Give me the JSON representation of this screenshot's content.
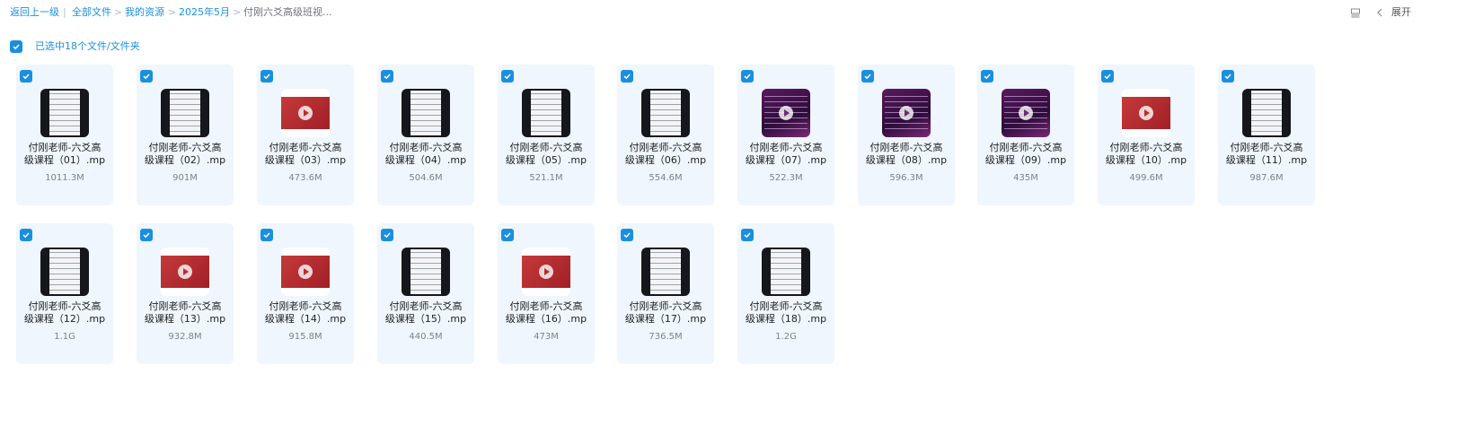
{
  "breadcrumb": {
    "back": "返回上一级",
    "items": [
      "全部文件",
      "我的资源",
      "2025年5月"
    ],
    "current": "付刚六爻高级班视..."
  },
  "toolbar": {
    "expand_label": "展开",
    "icons": [
      "list-view-icon",
      "chevron-left-icon"
    ]
  },
  "selection": {
    "text": "已选中18个文件/文件夹",
    "all_checked": true
  },
  "files": [
    {
      "name_line1": "付刚老师-六爻高",
      "name_line2": "级课程（01）.mp",
      "size": "1011.3M",
      "thumb": "doc"
    },
    {
      "name_line1": "付刚老师-六爻高",
      "name_line2": "级课程（02）.mp",
      "size": "901M",
      "thumb": "doc"
    },
    {
      "name_line1": "付刚老师-六爻高",
      "name_line2": "级课程（03）.mp",
      "size": "473.6M",
      "thumb": "red"
    },
    {
      "name_line1": "付刚老师-六爻高",
      "name_line2": "级课程（04）.mp",
      "size": "504.6M",
      "thumb": "doc"
    },
    {
      "name_line1": "付刚老师-六爻高",
      "name_line2": "级课程（05）.mp",
      "size": "521.1M",
      "thumb": "doc"
    },
    {
      "name_line1": "付刚老师-六爻高",
      "name_line2": "级课程（06）.mp",
      "size": "554.6M",
      "thumb": "doc"
    },
    {
      "name_line1": "付刚老师-六爻高",
      "name_line2": "级课程（07）.mp",
      "size": "522.3M",
      "thumb": "purple"
    },
    {
      "name_line1": "付刚老师-六爻高",
      "name_line2": "级课程（08）.mp",
      "size": "596.3M",
      "thumb": "purple"
    },
    {
      "name_line1": "付刚老师-六爻高",
      "name_line2": "级课程（09）.mp",
      "size": "435M",
      "thumb": "purple"
    },
    {
      "name_line1": "付刚老师-六爻高",
      "name_line2": "级课程（10）.mp",
      "size": "499.6M",
      "thumb": "red"
    },
    {
      "name_line1": "付刚老师-六爻高",
      "name_line2": "级课程（11）.mp",
      "size": "987.6M",
      "thumb": "doc"
    },
    {
      "name_line1": "付刚老师-六爻高",
      "name_line2": "级课程（12）.mp",
      "size": "1.1G",
      "thumb": "doc"
    },
    {
      "name_line1": "付刚老师-六爻高",
      "name_line2": "级课程（13）.mp",
      "size": "932.8M",
      "thumb": "red"
    },
    {
      "name_line1": "付刚老师-六爻高",
      "name_line2": "级课程（14）.mp",
      "size": "915.8M",
      "thumb": "red"
    },
    {
      "name_line1": "付刚老师-六爻高",
      "name_line2": "级课程（15）.mp",
      "size": "440.5M",
      "thumb": "doc"
    },
    {
      "name_line1": "付刚老师-六爻高",
      "name_line2": "级课程（16）.mp",
      "size": "473M",
      "thumb": "red"
    },
    {
      "name_line1": "付刚老师-六爻高",
      "name_line2": "级课程（17）.mp",
      "size": "736.5M",
      "thumb": "doc"
    },
    {
      "name_line1": "付刚老师-六爻高",
      "name_line2": "级课程（18）.mp",
      "size": "1.2G",
      "thumb": "doc"
    }
  ],
  "colors": {
    "accent": "#1a8fe0",
    "card_bg": "#eff6fd"
  }
}
